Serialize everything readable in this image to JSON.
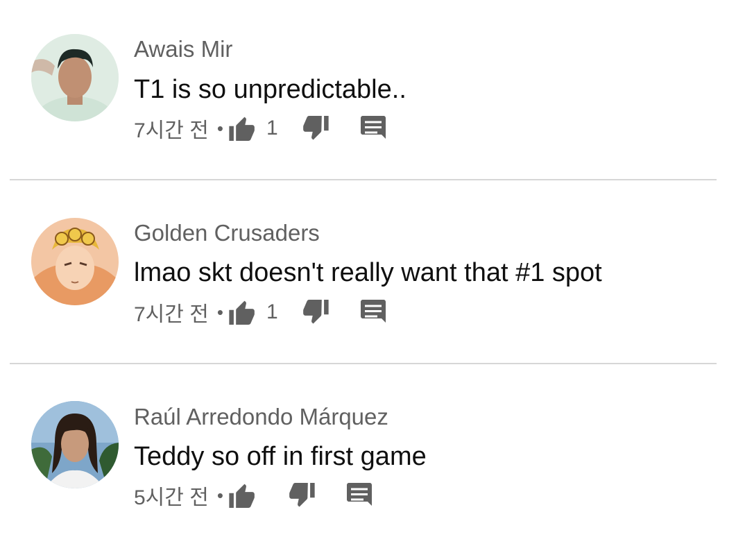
{
  "comments": [
    {
      "author": "Awais Mir",
      "text": "T1 is so unpredictable..",
      "time": "7시간 전",
      "dot": "•",
      "likes": "1",
      "avatar": "avatar-person-green-tint"
    },
    {
      "author": "Golden Crusaders",
      "text": "lmao skt doesn't really want that #1 spot",
      "time": "7시간 전",
      "dot": "•",
      "likes": "1",
      "avatar": "avatar-anime-character"
    },
    {
      "author": "Raúl Arredondo Márquez",
      "text": "Teddy so off in first game",
      "time": "5시간 전",
      "dot": "•",
      "likes": "",
      "avatar": "avatar-person-long-hair"
    }
  ],
  "icons": {
    "like": "thumbs-up-icon",
    "dislike": "thumbs-down-icon",
    "reply": "reply-comment-icon"
  },
  "colors": {
    "meta": "#606060",
    "text": "#0f0f0f",
    "divider": "#d6d6d6"
  }
}
